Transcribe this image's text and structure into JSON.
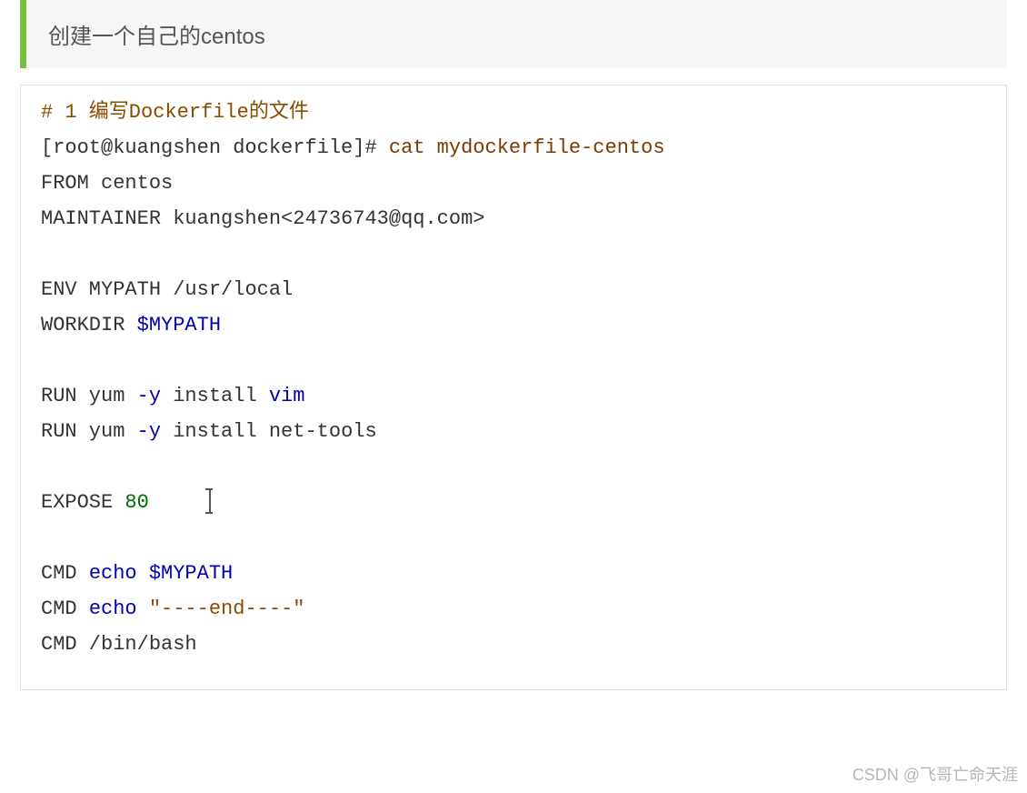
{
  "quote": "创建一个自己的centos",
  "code": {
    "l1_comment": "# 1 编写Dockerfile的文件",
    "l2_a": "[root@kuangshen dockerfile]# ",
    "l2_b": "cat mydockerfile-centos",
    "l3": "FROM centos",
    "l4": "MAINTAINER kuangshen<24736743@qq.com>",
    "l6_a": "ENV MYPATH ",
    "l6_b": "/usr/local",
    "l7_a": "WORKDIR ",
    "l7_b": "$MYPATH",
    "l9_a": "RUN yum ",
    "l9_b": "-y",
    "l9_c": " install ",
    "l9_d": "vim",
    "l10_a": "RUN yum ",
    "l10_b": "-y",
    "l10_c": " install net-tools",
    "l12_a": "EXPOSE ",
    "l12_b": "80",
    "l14_a": "CMD ",
    "l14_b": "echo",
    "l14_c": " ",
    "l14_d": "$MYPATH",
    "l15_a": "CMD ",
    "l15_b": "echo",
    "l15_c": " ",
    "l15_d": "\"----end----\"",
    "l16": "CMD /bin/bash"
  },
  "watermark": "CSDN @飞哥亡命天涯"
}
